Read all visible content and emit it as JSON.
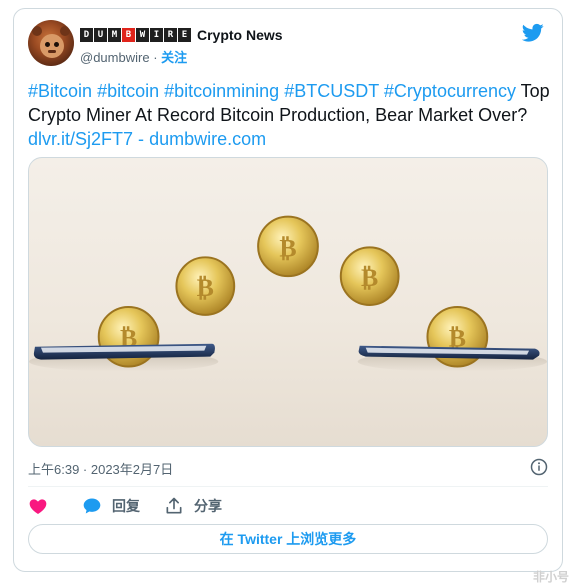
{
  "account": {
    "logo_letters": [
      "D",
      "U",
      "M",
      "B",
      "W",
      "I",
      "R",
      "E"
    ],
    "display_name": "Crypto News",
    "handle": "@dumbwire",
    "separator": "·",
    "follow_label": "关注"
  },
  "tweet": {
    "hashtags": [
      "#Bitcoin",
      "#bitcoin",
      "#bitcoinmining",
      "#BTCUSDT",
      "#Cryptocurrency"
    ],
    "text": "Top Crypto Miner At Record Bitcoin Production, Bear Market Over?",
    "link_short": "dlvr.it/Sj2FT7",
    "link_sep": "-",
    "link_domain": "dumbwire.com"
  },
  "timestamp": "上午6:39 · 2023年2月7日",
  "actions": {
    "like_label": "",
    "reply_label": "回复",
    "share_label": "分享"
  },
  "more_button": "在 Twitter 上浏览更多",
  "watermark": "非小号",
  "colors": {
    "accent": "#1d9bf0",
    "like": "#f91880",
    "text": "#0f1419",
    "muted": "#536471",
    "coin": "#d4b44a"
  },
  "icons": {
    "brand": "twitter-bird-icon",
    "info": "info-circle-icon",
    "like": "heart-icon",
    "reply": "speech-bubble-icon",
    "share": "share-upload-icon"
  }
}
